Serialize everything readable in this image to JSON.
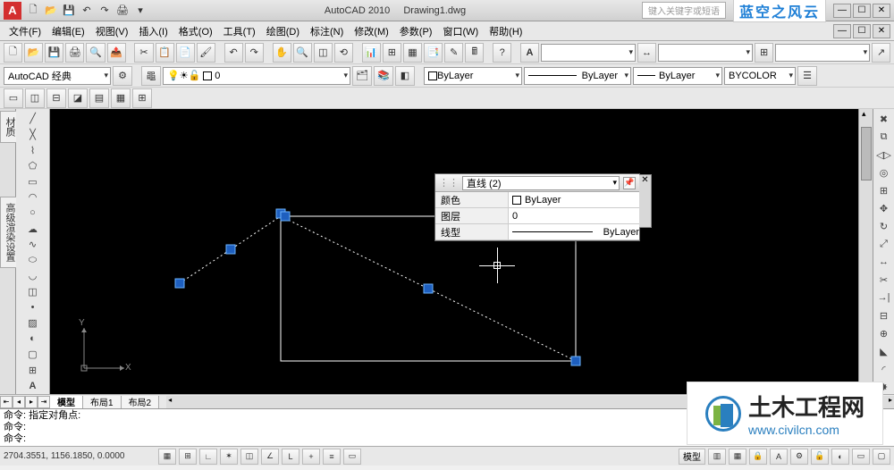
{
  "titlebar": {
    "app_letter": "A",
    "app_name": "AutoCAD 2010",
    "doc_name": "Drawing1.dwg",
    "search_hint": "键入关键字或短语",
    "watermark_top": "蓝空之风云"
  },
  "menu": {
    "items": [
      "文件(F)",
      "编辑(E)",
      "视图(V)",
      "插入(I)",
      "格式(O)",
      "工具(T)",
      "绘图(D)",
      "标注(N)",
      "修改(M)",
      "参数(P)",
      "窗口(W)",
      "帮助(H)"
    ]
  },
  "workspace_combo": "AutoCAD 经典",
  "layer_props": {
    "layer_dd": "ByLayer",
    "linetype_dd": "ByLayer",
    "lineweight_dd": "ByLayer",
    "color_field": "BYCOLOR"
  },
  "props_panel": {
    "title_combo": "直线 (2)",
    "rows": [
      {
        "label": "颜色",
        "value": "ByLayer",
        "swatch": true
      },
      {
        "label": "图层",
        "value": "0"
      },
      {
        "label": "线型",
        "value": "ByLayer",
        "line": true
      }
    ]
  },
  "ucs": {
    "x": "X",
    "y": "Y"
  },
  "layout_tabs": {
    "tabs": [
      "模型",
      "布局1",
      "布局2"
    ]
  },
  "command": {
    "lines": [
      "命令: 指定对角点:",
      "命令:",
      "命令:"
    ]
  },
  "statusbar": {
    "coords": "2704.3551, 1156.1850, 0.0000",
    "space_label": "模型"
  },
  "side_tabs": {
    "left1": "材质",
    "left2": "高级渲染设置"
  },
  "watermark_bottom": {
    "title": "土木工程网",
    "url": "www.civilcn.com"
  }
}
